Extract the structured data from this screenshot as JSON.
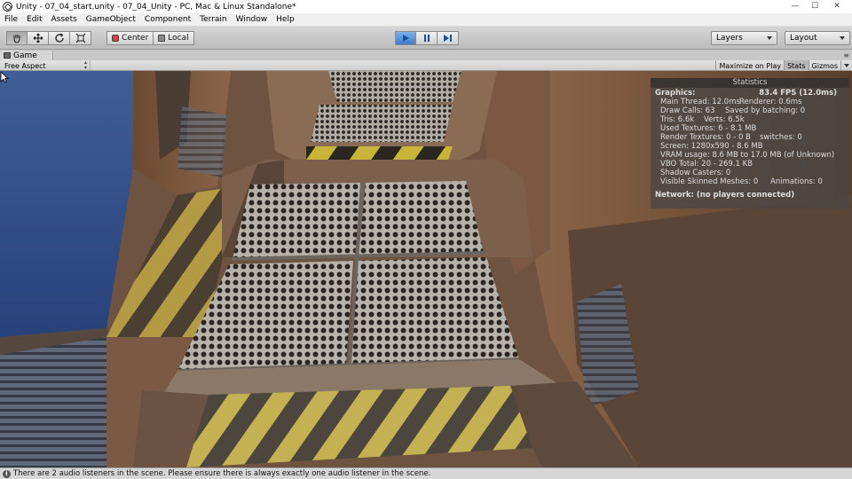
{
  "window": {
    "title": "Unity - 07_04_start.unity - 07_04_Unity - PC, Mac & Linux Standalone*",
    "minimize_glyph": "—",
    "maximize_glyph": "☐",
    "close_glyph": "✕"
  },
  "menu": [
    "File",
    "Edit",
    "Assets",
    "GameObject",
    "Component",
    "Terrain",
    "Window",
    "Help"
  ],
  "toolbar": {
    "pivot_label": "Center",
    "space_label": "Local",
    "layers_label": "Layers",
    "layout_label": "Layout"
  },
  "game_tab": {
    "label": "Game",
    "options_glyph": "≡",
    "aspect_label": "Free Aspect",
    "maximize_label": "Maximize on Play",
    "stats_label": "Stats",
    "gizmos_label": "Gizmos"
  },
  "stats": {
    "title": "Statistics",
    "graphics_label": "Graphics:",
    "fps": "83.4 FPS (12.0ms)",
    "main_thread": "Main Thread: 12.0ms",
    "renderer": "Renderer: 0.6ms",
    "draw_calls": "Draw Calls: 63",
    "saved_batching": "Saved by batching: 0",
    "tris": "Tris: 6.6k",
    "verts": "Verts: 6.5k",
    "used_textures": "Used Textures: 6 - 8.1 MB",
    "render_textures": "Render Textures: 0 - 0 B",
    "switches": "switches: 0",
    "screen": "Screen: 1280x590 - 8.6 MB",
    "vram": "VRAM usage: 8.6 MB to 17.0 MB (of Unknown)",
    "vbo": "VBO Total: 20 - 269.1 KB",
    "shadow_casters": "Shadow Casters: 0",
    "skinned_meshes": "Visible Skinned Meshes: 0",
    "animations": "Animations: 0",
    "network": "Network: (no players connected)"
  },
  "status": {
    "message": "There are 2 audio listeners in the scene. Please ensure there is always exactly one audio listener in the scene."
  }
}
